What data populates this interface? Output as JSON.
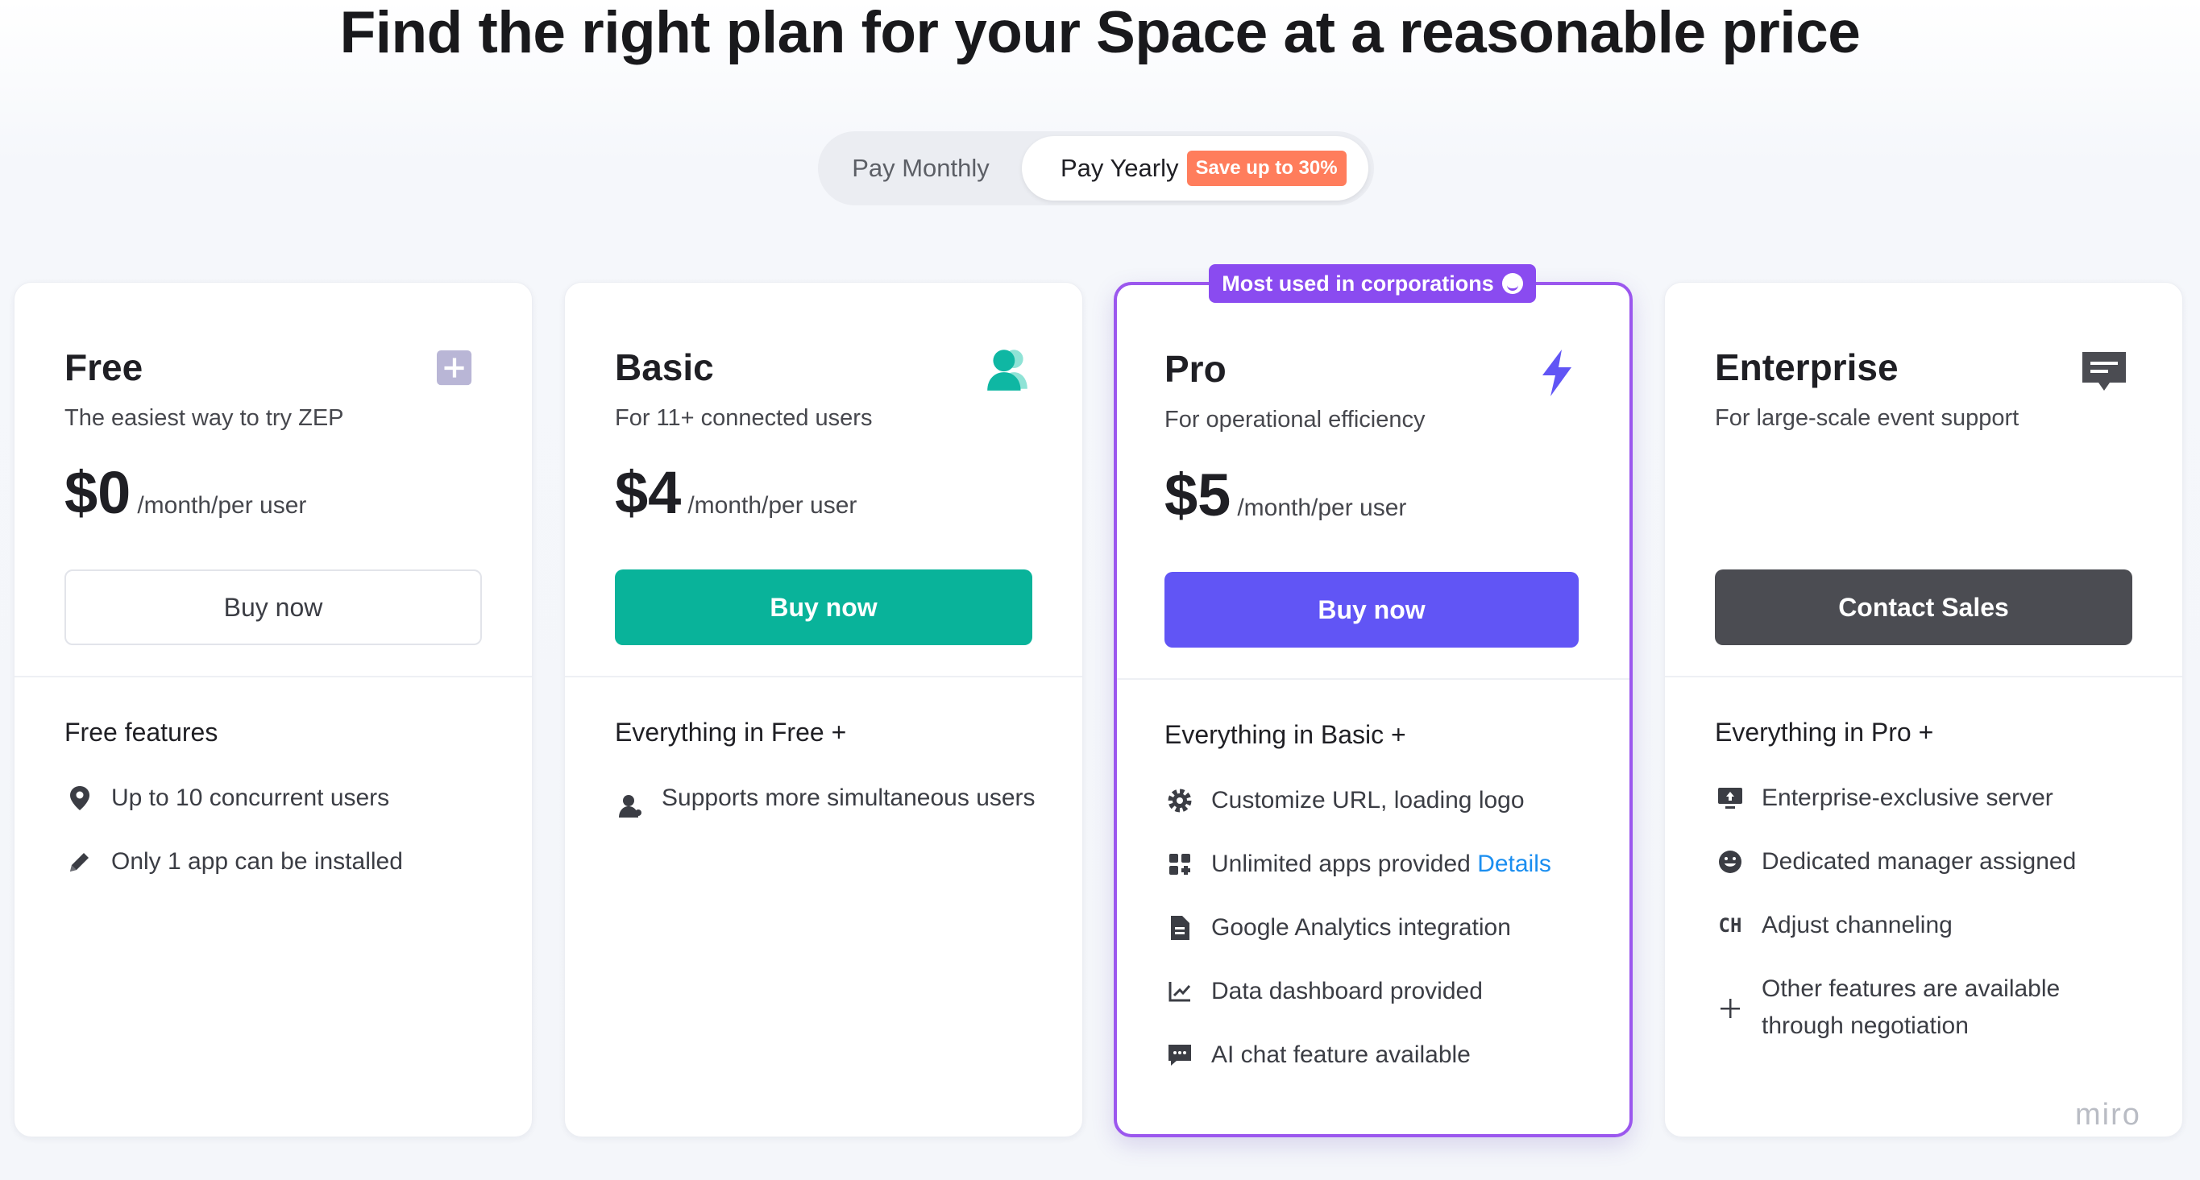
{
  "headline": "Find the right plan for your Space at a reasonable price",
  "billing_toggle": {
    "monthly_label": "Pay Monthly",
    "yearly_label": "Pay Yearly",
    "save_badge": "Save up to 30%",
    "selected": "Pay Yearly"
  },
  "pro_badge": "Most used in corporations",
  "plans": [
    {
      "name": "Free",
      "description": "The easiest way to try ZEP",
      "price": "$0",
      "price_unit": "/month/per user",
      "button_label": "Buy now",
      "features_title": "Free features",
      "icon": "plus-square-icon",
      "features": [
        {
          "icon": "location-pin-icon",
          "text": "Up to 10 concurrent users"
        },
        {
          "icon": "pencil-icon",
          "text": "Only 1 app can be installed"
        }
      ]
    },
    {
      "name": "Basic",
      "description": "For 11+ connected users",
      "price": "$4",
      "price_unit": "/month/per user",
      "button_label": "Buy now",
      "features_title": "Everything in Free +",
      "icon": "users-icon",
      "features": [
        {
          "icon": "user-icon",
          "text": "Supports more simultaneous users"
        }
      ]
    },
    {
      "name": "Pro",
      "description": "For operational efficiency",
      "price": "$5",
      "price_unit": "/month/per user",
      "button_label": "Buy now",
      "features_title": "Everything in Basic +",
      "icon": "lightning-icon",
      "features": [
        {
          "icon": "gear-icon",
          "text": "Customize URL, loading logo"
        },
        {
          "icon": "apps-grid-icon",
          "text": "Unlimited apps provided",
          "link": "Details"
        },
        {
          "icon": "document-icon",
          "text": "Google Analytics integration"
        },
        {
          "icon": "chart-line-icon",
          "text": "Data dashboard provided"
        },
        {
          "icon": "chat-icon",
          "text": "AI chat feature available"
        }
      ]
    },
    {
      "name": "Enterprise",
      "description": "For large-scale event support",
      "price": "",
      "price_unit": "",
      "button_label": "Contact Sales",
      "features_title": "Everything in Pro +",
      "icon": "message-icon",
      "features": [
        {
          "icon": "server-monitor-icon",
          "text": "Enterprise-exclusive server"
        },
        {
          "icon": "smile-icon",
          "text": "Dedicated manager assigned"
        },
        {
          "icon": "ch-text-icon",
          "text": "Adjust channeling",
          "glyph": "CH"
        },
        {
          "icon": "plus-icon",
          "text": "Other features are available through negotiation"
        }
      ]
    }
  ],
  "watermark": "miro",
  "colors": {
    "teal": "#09b39a",
    "purple_button": "#6155f5",
    "pro_border": "#9b57ee",
    "dark_button": "#4b4c52",
    "save_badge": "#ff7d5c",
    "link": "#1a8ef0"
  }
}
